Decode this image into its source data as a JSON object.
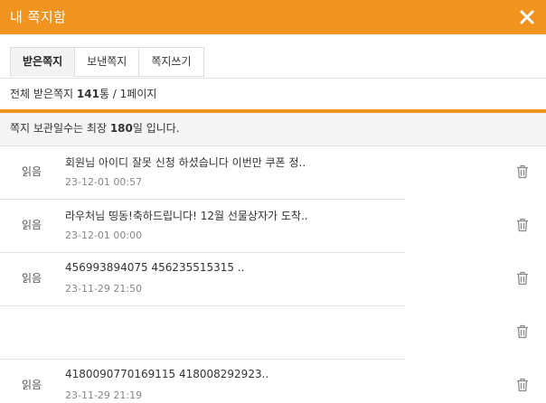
{
  "header": {
    "title": "내 쪽지함",
    "close_icon": "close-icon"
  },
  "tabs": [
    {
      "label": "받은쪽지",
      "active": true
    },
    {
      "label": "보낸쪽지",
      "active": false
    },
    {
      "label": "쪽지쓰기",
      "active": false
    }
  ],
  "summary": {
    "prefix": "전체 받은쪽지 ",
    "count": "141",
    "suffix": "통 / 1페이지"
  },
  "notice": {
    "prefix": "쪽지 보관일수는 최장 ",
    "days": "180",
    "suffix": "일 입니다."
  },
  "messages": [
    {
      "status": "읽음",
      "title": "회원님 아이디 잘못 신청 하셨습니다 이번만 쿠폰 정..",
      "date": "23-12-01 00:57"
    },
    {
      "status": "읽음",
      "title": "라우처님 띵동!축하드립니다! 12월 선물상자가 도착..",
      "date": "23-12-01 00:00"
    },
    {
      "status": "읽음",
      "title": "456993894075 456235515315 ..",
      "date": "23-11-29 21:50"
    },
    {
      "status": "",
      "title": "",
      "date": ""
    },
    {
      "status": "읽음",
      "title": "4180090770169115 418008292923..",
      "date": "23-11-29 21:19"
    }
  ],
  "icons": {
    "delete": "trash-icon"
  },
  "colors": {
    "accent": "#f0941f",
    "notice_bg": "#f5f5f5",
    "active_tab_bg": "#f3f3f3"
  }
}
